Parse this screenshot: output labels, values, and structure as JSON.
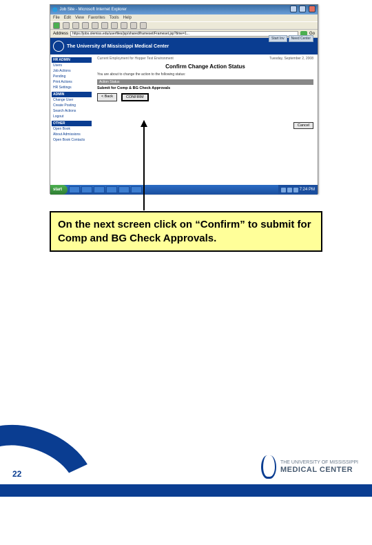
{
  "slide": {
    "page_number": "22",
    "caption": "On the next screen click on “Confirm” to submit for Comp and BG Check Approvals."
  },
  "screenshot": {
    "window_title": "Job Site - Microsoft Internet Explorer",
    "menu": [
      "File",
      "Edit",
      "View",
      "Favorites",
      "Tools",
      "Help"
    ],
    "address_label": "Address",
    "url": "https://jobs.olemiss.edu/userfiles/jsp/shared/frameset/Frameset.jsp?time=1...",
    "go_label": "Go",
    "banner_title": "The University of Mississippi Medical Center",
    "banner_tabs": [
      "Start Inv",
      "Need Center"
    ],
    "sidebar": {
      "sections": [
        {
          "header": "HR ADMIN",
          "items": [
            "Users",
            "Job Actions",
            "Pending",
            "Print Actions",
            "HR Settings"
          ]
        },
        {
          "header": "ADMIN",
          "items": [
            "Change User",
            "Create Posting",
            "Search Actions",
            "Logout"
          ]
        },
        {
          "header": "OTHER",
          "items": [
            "Open Book",
            "About Admissions",
            "Open Book Contacts"
          ]
        }
      ]
    },
    "main": {
      "breadcrumb": "Current   Employment   for   Hopper Test Environment",
      "date": "Tuesday, September 2, 2008",
      "title": "Confirm Change Action Status",
      "subtitle": "You are about to change the action to the following status:",
      "section_bar": "Action Status",
      "status_line": "Submit for Comp & BG Check Approvals",
      "buttons": {
        "back": "< Back",
        "confirm": "CONFIRM",
        "cancel": "Cancel"
      }
    },
    "taskbar": {
      "start": "start",
      "clock": "7:24 PM"
    }
  },
  "footer_logo": {
    "lines": [
      "THE UNIVERSITY OF MISSISSIPPI",
      "MEDICAL CENTER"
    ]
  }
}
